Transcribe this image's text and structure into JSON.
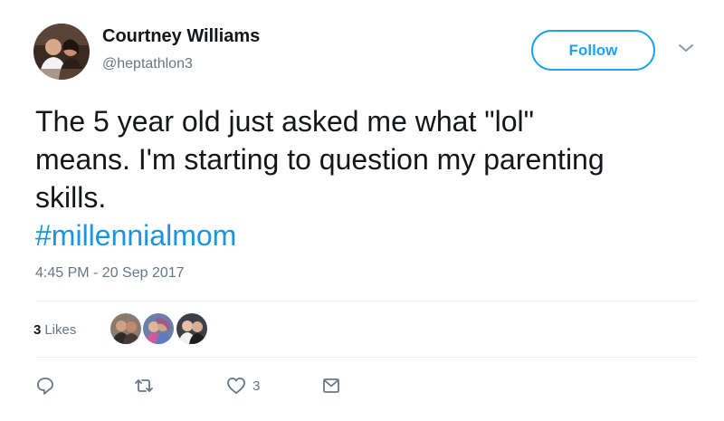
{
  "author": {
    "name": "Courtney Williams",
    "handle": "@heptathlon3"
  },
  "header": {
    "follow_label": "Follow",
    "caret_icon": "chevron-down-icon"
  },
  "tweet": {
    "text_lines": [
      "The 5 year old just asked me what \"lol\"",
      "means. I'm starting to question my parenting",
      "skills."
    ],
    "hashtag": "#millennialmom",
    "timestamp": "4:45 PM - 20 Sep 2017"
  },
  "stats": {
    "likes_count": "3",
    "likes_label": "Likes"
  },
  "actions": {
    "reply_icon": "reply-icon",
    "retweet_icon": "retweet-icon",
    "like_icon": "heart-icon",
    "like_count": "3",
    "dm_icon": "envelope-icon"
  },
  "colors": {
    "accent": "#1da1f2",
    "hashtag": "#1b95e0",
    "secondary_text": "#657786",
    "divider": "#e6ecf0"
  }
}
